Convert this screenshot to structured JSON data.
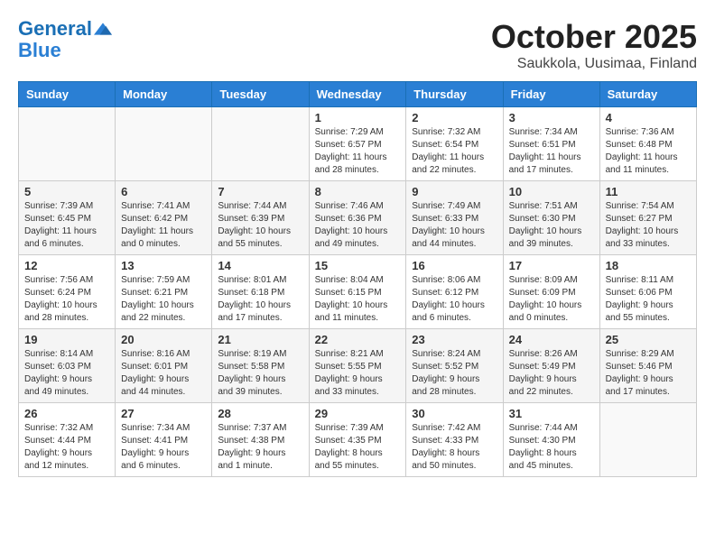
{
  "header": {
    "logo_line1": "General",
    "logo_line2": "Blue",
    "month": "October 2025",
    "location": "Saukkola, Uusimaa, Finland"
  },
  "weekdays": [
    "Sunday",
    "Monday",
    "Tuesday",
    "Wednesday",
    "Thursday",
    "Friday",
    "Saturday"
  ],
  "weeks": [
    [
      {
        "day": "",
        "info": ""
      },
      {
        "day": "",
        "info": ""
      },
      {
        "day": "",
        "info": ""
      },
      {
        "day": "1",
        "info": "Sunrise: 7:29 AM\nSunset: 6:57 PM\nDaylight: 11 hours\nand 28 minutes."
      },
      {
        "day": "2",
        "info": "Sunrise: 7:32 AM\nSunset: 6:54 PM\nDaylight: 11 hours\nand 22 minutes."
      },
      {
        "day": "3",
        "info": "Sunrise: 7:34 AM\nSunset: 6:51 PM\nDaylight: 11 hours\nand 17 minutes."
      },
      {
        "day": "4",
        "info": "Sunrise: 7:36 AM\nSunset: 6:48 PM\nDaylight: 11 hours\nand 11 minutes."
      }
    ],
    [
      {
        "day": "5",
        "info": "Sunrise: 7:39 AM\nSunset: 6:45 PM\nDaylight: 11 hours\nand 6 minutes."
      },
      {
        "day": "6",
        "info": "Sunrise: 7:41 AM\nSunset: 6:42 PM\nDaylight: 11 hours\nand 0 minutes."
      },
      {
        "day": "7",
        "info": "Sunrise: 7:44 AM\nSunset: 6:39 PM\nDaylight: 10 hours\nand 55 minutes."
      },
      {
        "day": "8",
        "info": "Sunrise: 7:46 AM\nSunset: 6:36 PM\nDaylight: 10 hours\nand 49 minutes."
      },
      {
        "day": "9",
        "info": "Sunrise: 7:49 AM\nSunset: 6:33 PM\nDaylight: 10 hours\nand 44 minutes."
      },
      {
        "day": "10",
        "info": "Sunrise: 7:51 AM\nSunset: 6:30 PM\nDaylight: 10 hours\nand 39 minutes."
      },
      {
        "day": "11",
        "info": "Sunrise: 7:54 AM\nSunset: 6:27 PM\nDaylight: 10 hours\nand 33 minutes."
      }
    ],
    [
      {
        "day": "12",
        "info": "Sunrise: 7:56 AM\nSunset: 6:24 PM\nDaylight: 10 hours\nand 28 minutes."
      },
      {
        "day": "13",
        "info": "Sunrise: 7:59 AM\nSunset: 6:21 PM\nDaylight: 10 hours\nand 22 minutes."
      },
      {
        "day": "14",
        "info": "Sunrise: 8:01 AM\nSunset: 6:18 PM\nDaylight: 10 hours\nand 17 minutes."
      },
      {
        "day": "15",
        "info": "Sunrise: 8:04 AM\nSunset: 6:15 PM\nDaylight: 10 hours\nand 11 minutes."
      },
      {
        "day": "16",
        "info": "Sunrise: 8:06 AM\nSunset: 6:12 PM\nDaylight: 10 hours\nand 6 minutes."
      },
      {
        "day": "17",
        "info": "Sunrise: 8:09 AM\nSunset: 6:09 PM\nDaylight: 10 hours\nand 0 minutes."
      },
      {
        "day": "18",
        "info": "Sunrise: 8:11 AM\nSunset: 6:06 PM\nDaylight: 9 hours\nand 55 minutes."
      }
    ],
    [
      {
        "day": "19",
        "info": "Sunrise: 8:14 AM\nSunset: 6:03 PM\nDaylight: 9 hours\nand 49 minutes."
      },
      {
        "day": "20",
        "info": "Sunrise: 8:16 AM\nSunset: 6:01 PM\nDaylight: 9 hours\nand 44 minutes."
      },
      {
        "day": "21",
        "info": "Sunrise: 8:19 AM\nSunset: 5:58 PM\nDaylight: 9 hours\nand 39 minutes."
      },
      {
        "day": "22",
        "info": "Sunrise: 8:21 AM\nSunset: 5:55 PM\nDaylight: 9 hours\nand 33 minutes."
      },
      {
        "day": "23",
        "info": "Sunrise: 8:24 AM\nSunset: 5:52 PM\nDaylight: 9 hours\nand 28 minutes."
      },
      {
        "day": "24",
        "info": "Sunrise: 8:26 AM\nSunset: 5:49 PM\nDaylight: 9 hours\nand 22 minutes."
      },
      {
        "day": "25",
        "info": "Sunrise: 8:29 AM\nSunset: 5:46 PM\nDaylight: 9 hours\nand 17 minutes."
      }
    ],
    [
      {
        "day": "26",
        "info": "Sunrise: 7:32 AM\nSunset: 4:44 PM\nDaylight: 9 hours\nand 12 minutes."
      },
      {
        "day": "27",
        "info": "Sunrise: 7:34 AM\nSunset: 4:41 PM\nDaylight: 9 hours\nand 6 minutes."
      },
      {
        "day": "28",
        "info": "Sunrise: 7:37 AM\nSunset: 4:38 PM\nDaylight: 9 hours\nand 1 minute."
      },
      {
        "day": "29",
        "info": "Sunrise: 7:39 AM\nSunset: 4:35 PM\nDaylight: 8 hours\nand 55 minutes."
      },
      {
        "day": "30",
        "info": "Sunrise: 7:42 AM\nSunset: 4:33 PM\nDaylight: 8 hours\nand 50 minutes."
      },
      {
        "day": "31",
        "info": "Sunrise: 7:44 AM\nSunset: 4:30 PM\nDaylight: 8 hours\nand 45 minutes."
      },
      {
        "day": "",
        "info": ""
      }
    ]
  ]
}
